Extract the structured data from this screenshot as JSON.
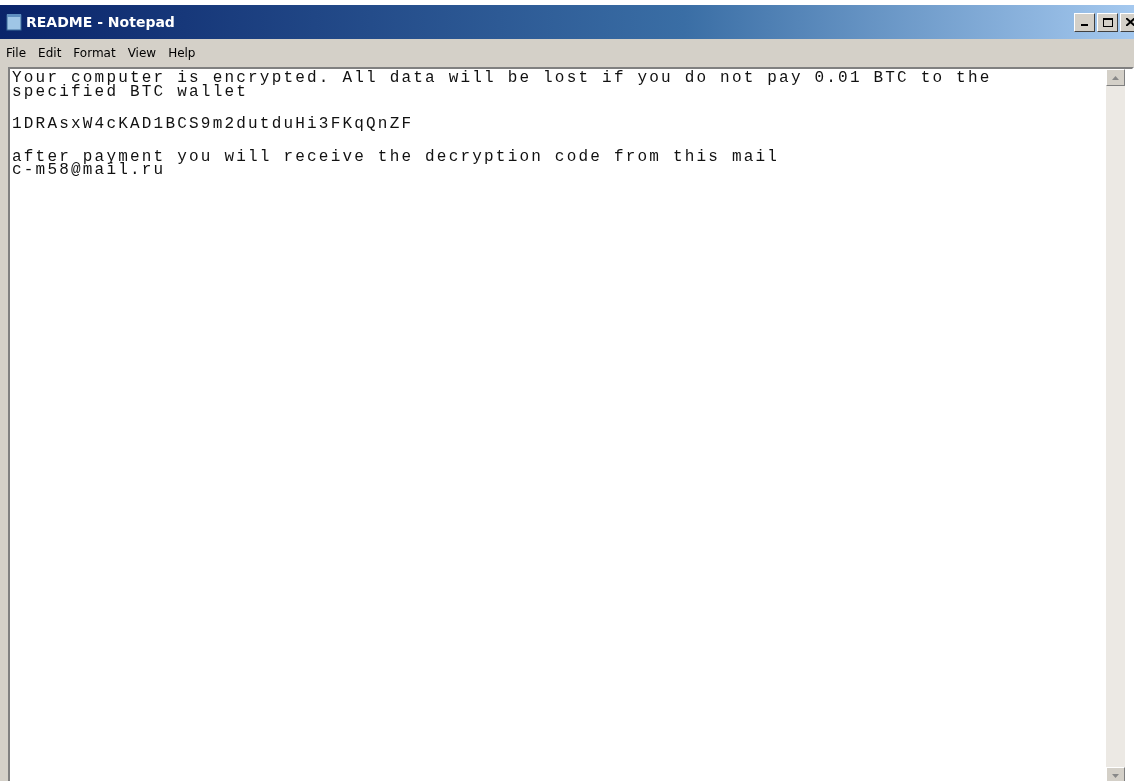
{
  "window": {
    "title": "README - Notepad"
  },
  "menu": [
    "File",
    "Edit",
    "Format",
    "View",
    "Help"
  ],
  "document": {
    "paragraphs": [
      [
        "Your computer is encrypted. All data will be lost if you do not pay 0.01 BTC to the",
        "specified BTC wallet"
      ],
      [
        "1DRAsxW4cKAD1BCS9m2dutduHi3FKqQnZF"
      ],
      [
        "after payment you will receive the decryption code from this mail",
        "c-m58@mail.ru"
      ]
    ]
  }
}
